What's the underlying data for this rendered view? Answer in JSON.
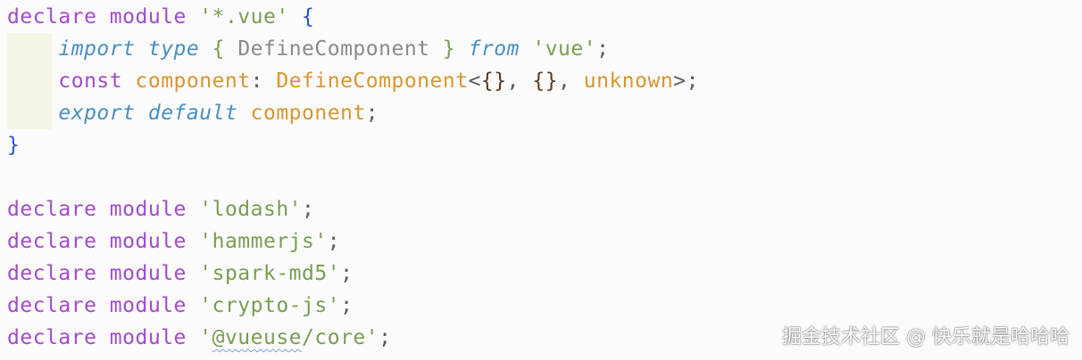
{
  "code": {
    "line1": {
      "kw1": "declare",
      "kw2": "module",
      "str": "'*.vue'",
      "brace": "{"
    },
    "line2": {
      "kw1": "import",
      "kw2": "type",
      "open": "{",
      "name": "DefineComponent",
      "close": "}",
      "kw3": "from",
      "str": "'vue'",
      "semi": ";"
    },
    "line3": {
      "kw": "const",
      "var": "component",
      "colon": ":",
      "type": "DefineComponent",
      "lt": "<",
      "g1": "{}",
      "comma1": ",",
      "g2": "{}",
      "comma2": ",",
      "g3": "unknown",
      "gt": ">",
      "semi": ";"
    },
    "line4": {
      "kw1": "export",
      "kw2": "default",
      "var": "component",
      "semi": ";"
    },
    "line5": {
      "brace": "}"
    },
    "modules": [
      {
        "kw1": "declare",
        "kw2": "module",
        "str": "'lodash'",
        "semi": ";"
      },
      {
        "kw1": "declare",
        "kw2": "module",
        "str": "'hammerjs'",
        "semi": ";"
      },
      {
        "kw1": "declare",
        "kw2": "module",
        "str": "'spark-md5'",
        "semi": ";"
      },
      {
        "kw1": "declare",
        "kw2": "module",
        "str": "'crypto-js'",
        "semi": ";"
      },
      {
        "kw1": "declare",
        "kw2": "module",
        "str_quote_open": "'",
        "str_squiggle": "@vueuse",
        "str_rest": "/core'",
        "semi": ";"
      }
    ]
  },
  "watermark": "掘金技术社区 @ 快乐就是哈哈哈",
  "colors": {
    "keyword": "#a04cc8",
    "keyword_italic": "#4a8fc1",
    "string": "#7a9d52",
    "identifier": "#d89531",
    "brace": "#2c52c8",
    "background": "#fbfbfb"
  }
}
